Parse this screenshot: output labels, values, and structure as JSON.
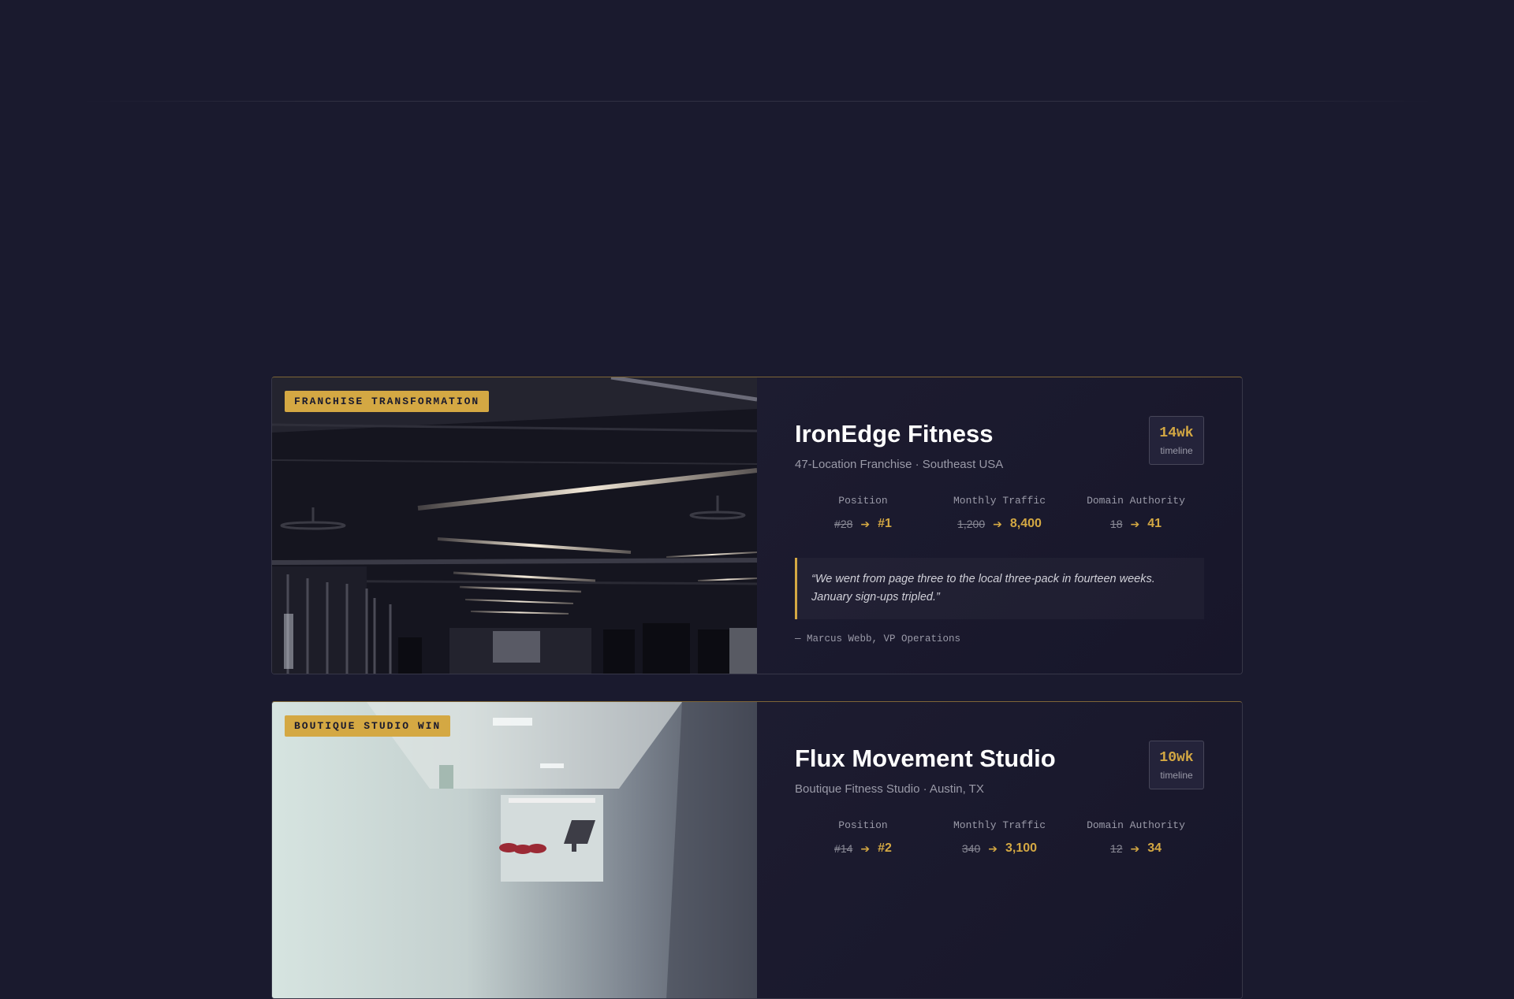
{
  "case_studies": [
    {
      "tag": "FRANCHISE TRANSFORMATION",
      "image_desc": "gym-interior-image",
      "title": "IronEdge Fitness",
      "subtitle": "47-Location Franchise · Southeast USA",
      "timeline_value": "14wk",
      "timeline_label": "timeline",
      "metrics": [
        {
          "label": "Position",
          "before": "#28",
          "after": "#1"
        },
        {
          "label": "Monthly Traffic",
          "before": "1,200",
          "after": "8,400"
        },
        {
          "label": "Domain Authority",
          "before": "18",
          "after": "41"
        }
      ],
      "quote": "“We went from page three to the local three-pack in fourteen weeks. January sign-ups tripled.”",
      "attribution": "— Marcus Webb, VP Operations"
    },
    {
      "tag": "BOUTIQUE STUDIO WIN",
      "image_desc": "studio-interior-image",
      "title": "Flux Movement Studio",
      "subtitle": "Boutique Fitness Studio · Austin, TX",
      "timeline_value": "10wk",
      "timeline_label": "timeline",
      "metrics": [
        {
          "label": "Position",
          "before": "#14",
          "after": "#2"
        },
        {
          "label": "Monthly Traffic",
          "before": "340",
          "after": "3,100"
        },
        {
          "label": "Domain Authority",
          "before": "12",
          "after": "34"
        }
      ]
    }
  ],
  "arrow_icon": "arrow-right-icon",
  "colors": {
    "accent": "#d4a843",
    "background": "#1a1a2e",
    "card": "#17172a"
  }
}
